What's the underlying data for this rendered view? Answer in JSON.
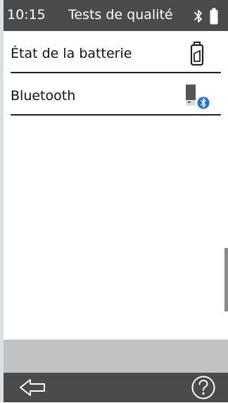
{
  "status": {
    "time": "10:15",
    "title": "Tests de qualité",
    "icons": [
      "bluetooth-icon",
      "battery-icon"
    ]
  },
  "list": {
    "items": [
      {
        "label": "État de la batterie",
        "icon": "battery-icon"
      },
      {
        "label": "Bluetooth",
        "icon": "device-bluetooth-icon"
      }
    ]
  },
  "navbar": {
    "icons": [
      "back-arrow-icon",
      "help-icon"
    ]
  },
  "colors": {
    "bar": "#4b4b4b",
    "gray_band": "#c2c2c2",
    "accent_blue": "#1e6fd6"
  }
}
